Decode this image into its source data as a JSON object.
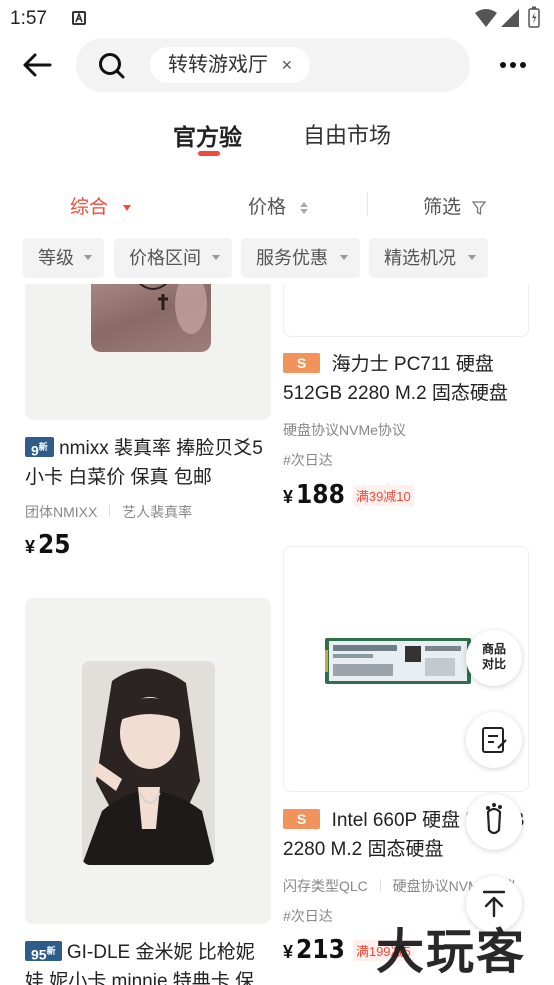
{
  "status": {
    "time": "1:57"
  },
  "search": {
    "chip_text": "转转游戏厅",
    "chip_close": "×"
  },
  "tabs": [
    {
      "label": "官方验",
      "active": true
    },
    {
      "label": "自由市场",
      "active": false
    }
  ],
  "sort": {
    "comprehensive": "综合",
    "price": "价格",
    "filter": "筛选"
  },
  "filters": [
    "等级",
    "价格区间",
    "服务优惠",
    "精选机况"
  ],
  "left": [
    {
      "badge": "9",
      "badge_sup": "新",
      "title": "nmixx 裴真率 捧脸贝爻5小卡 白菜价 保真 包邮",
      "tags": [
        "团体NMIXX",
        "艺人裴真率"
      ],
      "yen": "¥",
      "price": "25"
    },
    {
      "badge": "95",
      "badge_sup": "新",
      "title": "GI-DLE 金米妮 比枪妮娃 妮小卡 minnie 特典卡 保"
    }
  ],
  "right": [
    {
      "badge": "S",
      "title": "海力士 PC711 硬盘 512GB 2280 M.2 固态硬盘",
      "spec": [
        "硬盘协议NVMe协议"
      ],
      "delivery": "#次日达",
      "yen": "¥",
      "price": "188",
      "promo": "满39减10"
    },
    {
      "badge": "S",
      "title": "Intel 660P 硬盘 512GB 2280 M.2 固态硬盘",
      "spec": [
        "闪存类型QLC",
        "硬盘协议NVMe协议"
      ],
      "delivery": "#次日达",
      "yen": "¥",
      "price": "213",
      "promo": "满199减5"
    }
  ],
  "float": {
    "compare_line1": "商品",
    "compare_line2": "对比"
  },
  "watermark": "大玩客",
  "colors": {
    "accent": "#f04a3a",
    "badge_blue": "#2f5d8a",
    "badge_orange": "#f1935a"
  }
}
